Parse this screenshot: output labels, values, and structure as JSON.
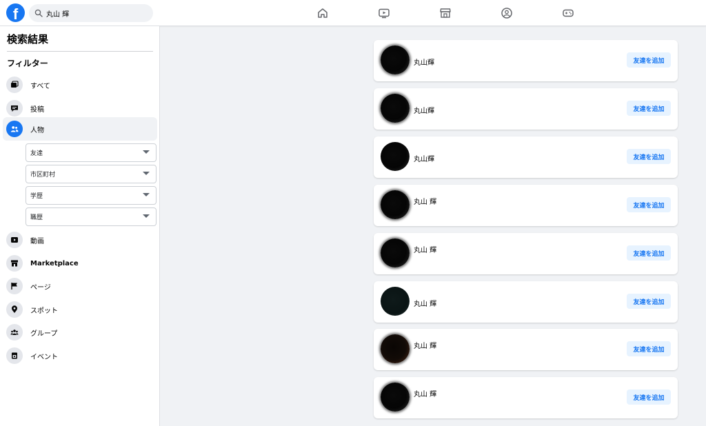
{
  "header": {
    "logo": "f",
    "search_value": "丸山 輝",
    "nav_icons": [
      "home-icon",
      "video-icon",
      "marketplace-icon",
      "groups-icon",
      "gaming-icon"
    ]
  },
  "sidebar": {
    "title": "検索結果",
    "filter_heading": "フィルター",
    "items": [
      {
        "label": "すべて",
        "icon": "all-icon"
      },
      {
        "label": "投稿",
        "icon": "posts-icon"
      },
      {
        "label": "人物",
        "icon": "people-icon",
        "active": true
      },
      {
        "label": "動画",
        "icon": "video-icon"
      },
      {
        "label": "Marketplace",
        "icon": "marketplace-icon"
      },
      {
        "label": "ページ",
        "icon": "flag-icon"
      },
      {
        "label": "スポット",
        "icon": "location-icon"
      },
      {
        "label": "グループ",
        "icon": "groups-icon"
      },
      {
        "label": "イベント",
        "icon": "event-icon"
      }
    ],
    "people_filters": [
      "友達",
      "市区町村",
      "学歴",
      "職歴"
    ]
  },
  "results": [
    {
      "name": "丸山輝",
      "button": "友達を追加"
    },
    {
      "name": "丸山輝",
      "button": "友達を追加"
    },
    {
      "name": "丸山輝",
      "button": "友達を追加"
    },
    {
      "name": "丸山 輝",
      "button": "友達を追加"
    },
    {
      "name": "丸山 輝",
      "button": "友達を追加"
    },
    {
      "name": "丸山 輝",
      "button": "友達を追加"
    },
    {
      "name": "丸山 輝",
      "button": "友達を追加"
    },
    {
      "name": "丸山 輝",
      "button": "友達を追加"
    }
  ],
  "colors": {
    "brand": "#1877f2",
    "button_bg": "#e7f3ff",
    "page_bg": "#f0f2f5"
  }
}
